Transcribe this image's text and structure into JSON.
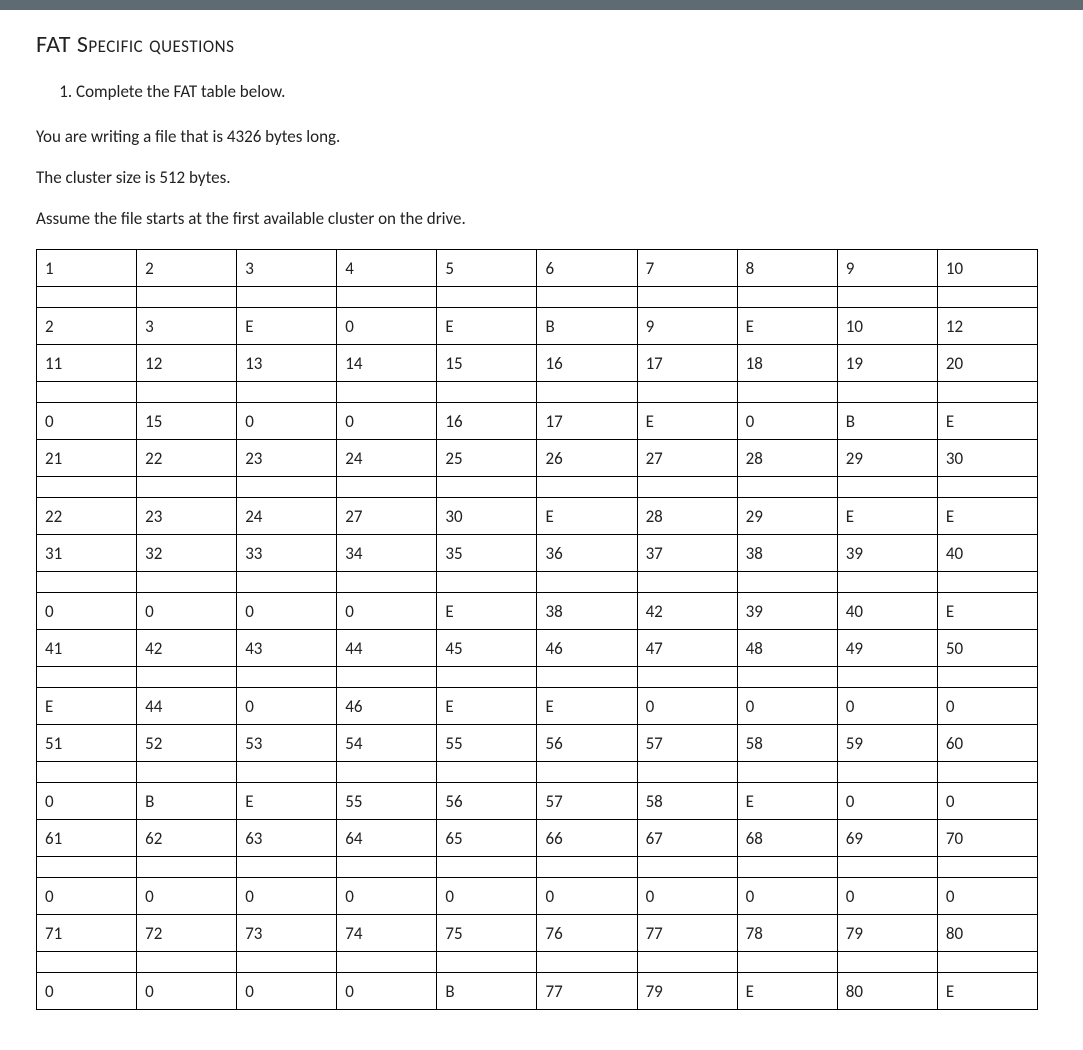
{
  "heading": "FAT Specific questions",
  "question_number": "1.",
  "question_text": "Complete the FAT table below.",
  "para1": "You are writing a file that is 4326 bytes long.",
  "para2": "The cluster size is 512 bytes.",
  "para3": "Assume the file starts at the first available cluster on the drive.",
  "fat_rows": [
    [
      "1",
      "2",
      "3",
      "4",
      "5",
      "6",
      "7",
      "8",
      "9",
      "10"
    ],
    "spacer",
    [
      "2",
      "3",
      "E",
      "0",
      "E",
      "B",
      "9",
      "E",
      "10",
      "12"
    ],
    [
      "11",
      "12",
      "13",
      "14",
      "15",
      "16",
      "17",
      "18",
      "19",
      "20"
    ],
    "spacer",
    [
      "0",
      "15",
      "0",
      "0",
      "16",
      "17",
      "E",
      "0",
      "B",
      "E"
    ],
    [
      "21",
      "22",
      "23",
      "24",
      "25",
      "26",
      "27",
      "28",
      "29",
      "30"
    ],
    "spacer",
    [
      "22",
      "23",
      "24",
      "27",
      "30",
      "E",
      "28",
      "29",
      "E",
      "E"
    ],
    [
      "31",
      "32",
      "33",
      "34",
      "35",
      "36",
      "37",
      "38",
      "39",
      "40"
    ],
    "spacer",
    [
      "0",
      "0",
      "0",
      "0",
      "E",
      "38",
      "42",
      "39",
      "40",
      "E"
    ],
    [
      "41",
      "42",
      "43",
      "44",
      "45",
      "46",
      "47",
      "48",
      "49",
      "50"
    ],
    "spacer",
    [
      "E",
      "44",
      "0",
      "46",
      "E",
      "E",
      "0",
      "0",
      "0",
      "0"
    ],
    [
      "51",
      "52",
      "53",
      "54",
      "55",
      "56",
      "57",
      "58",
      "59",
      "60"
    ],
    "spacer",
    [
      "0",
      "B",
      "E",
      "55",
      "56",
      "57",
      "58",
      "E",
      "0",
      "0"
    ],
    [
      "61",
      "62",
      "63",
      "64",
      "65",
      "66",
      "67",
      "68",
      "69",
      "70"
    ],
    "spacer",
    [
      "0",
      "0",
      "0",
      "0",
      "0",
      "0",
      "0",
      "0",
      "0",
      "0"
    ],
    [
      "71",
      "72",
      "73",
      "74",
      "75",
      "76",
      "77",
      "78",
      "79",
      "80"
    ],
    "spacer",
    [
      "0",
      "0",
      "0",
      "0",
      "B",
      "77",
      "79",
      "E",
      "80",
      "E"
    ]
  ]
}
